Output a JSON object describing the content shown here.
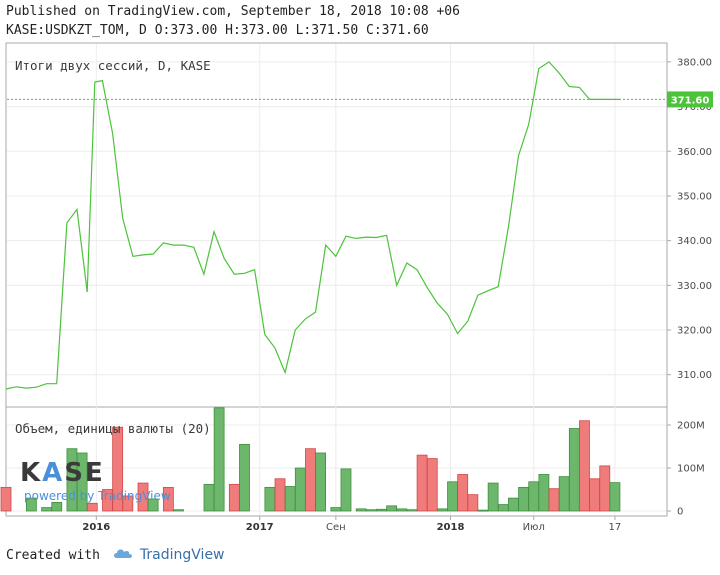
{
  "header": {
    "published": "Published on TradingView.com, September 18, 2018 10:08 +06",
    "ohlc": "KASE:USDKZT_TOM, D O:373.00 H:373.00 L:371.50 C:371.60"
  },
  "footer": {
    "created_with": "Created with",
    "brand": "TradingView"
  },
  "watermark": {
    "logo": "KASE",
    "powered": "powered by TradingView"
  },
  "colors": {
    "line": "#4cc33a",
    "price_tag": "#4cc33a",
    "volume_up": "#6db76d",
    "volume_down": "#f07b7b",
    "grid": "#ececec"
  },
  "chart_data": [
    {
      "type": "line",
      "pane_label": "Итоги двух сессий, D, KASE",
      "y_ticks": [
        "310.00",
        "320.00",
        "330.00",
        "340.00",
        "350.00",
        "360.00",
        "370.00",
        "380.00"
      ],
      "ylim": [
        303,
        384
      ],
      "last_value_label": "371.60",
      "last_value": 371.6,
      "t": [
        0,
        2,
        4,
        6,
        8,
        10,
        12,
        14,
        16,
        17.5,
        19,
        21,
        23,
        25,
        27,
        29,
        31,
        33,
        35,
        37,
        39,
        41,
        43,
        45,
        47,
        49,
        51,
        53,
        55,
        57,
        59,
        61,
        63,
        65,
        67,
        69,
        71,
        73,
        75,
        77,
        79,
        81,
        83,
        85,
        87,
        89,
        91,
        93,
        95,
        97,
        99,
        101,
        103,
        105,
        107,
        109,
        111,
        113,
        115,
        117,
        119,
        121
      ],
      "values": [
        306.8,
        307.3,
        307.0,
        307.2,
        308.0,
        308.0,
        344.0,
        347.0,
        328.5,
        375.5,
        375.8,
        364.0,
        345.0,
        336.5,
        336.8,
        337.0,
        339.5,
        339.0,
        339.0,
        338.5,
        332.5,
        342.0,
        336.0,
        332.5,
        332.7,
        333.5,
        319.0,
        316.0,
        310.5,
        320.0,
        322.5,
        324.0,
        339.0,
        336.5,
        341.0,
        340.5,
        340.8,
        340.7,
        341.2,
        330.0,
        335.0,
        333.5,
        329.5,
        326.0,
        323.5,
        319.2,
        322.0,
        327.8,
        328.8,
        329.7,
        343.0,
        359.0,
        366.0,
        378.5,
        380.0,
        377.5,
        374.5,
        374.3,
        371.6,
        371.6,
        371.6,
        371.6
      ]
    },
    {
      "type": "bar",
      "pane_label": "Объем, единицы валюты (20)",
      "y_ticks": [
        "0",
        "100M",
        "200M"
      ],
      "ylim": [
        0,
        235
      ],
      "x_tick_labels": [
        {
          "label": "2016",
          "bold": true,
          "t": 17.8
        },
        {
          "label": "2017",
          "bold": true,
          "t": 50
        },
        {
          "label": "Сен",
          "bold": false,
          "t": 65
        },
        {
          "label": "2018",
          "bold": true,
          "t": 87.6
        },
        {
          "label": "Июл",
          "bold": false,
          "t": 104
        },
        {
          "label": "17",
          "bold": false,
          "t": 120
        }
      ],
      "t": [
        0,
        5,
        8,
        10,
        13,
        15,
        17,
        20,
        22,
        24,
        27,
        29,
        32,
        34,
        40,
        42,
        45,
        47,
        52,
        54,
        56,
        58,
        60,
        62,
        65,
        67,
        70,
        72,
        74,
        76,
        78,
        80,
        82,
        84,
        86,
        88,
        90,
        92,
        94,
        96,
        98,
        100,
        102,
        104,
        106,
        108,
        110,
        112,
        114,
        116,
        118,
        120
      ],
      "values": [
        55,
        30,
        8,
        20,
        145,
        135,
        18,
        50,
        195,
        35,
        65,
        28,
        55,
        3,
        62,
        240,
        62,
        155,
        55,
        75,
        57,
        100,
        145,
        135,
        8,
        98,
        5,
        3,
        4,
        12,
        5,
        3,
        130,
        122,
        5,
        68,
        85,
        38,
        2,
        65,
        15,
        30,
        55,
        68,
        85,
        52,
        80,
        192,
        210,
        75,
        105,
        66
      ],
      "up": [
        false,
        true,
        true,
        true,
        true,
        true,
        false,
        false,
        false,
        false,
        false,
        true,
        false,
        true,
        true,
        true,
        false,
        true,
        true,
        false,
        true,
        true,
        false,
        true,
        true,
        true,
        true,
        true,
        true,
        true,
        true,
        true,
        false,
        false,
        true,
        true,
        false,
        false,
        true,
        true,
        true,
        true,
        true,
        true,
        true,
        false,
        true,
        true,
        false,
        false,
        false,
        true
      ]
    }
  ]
}
